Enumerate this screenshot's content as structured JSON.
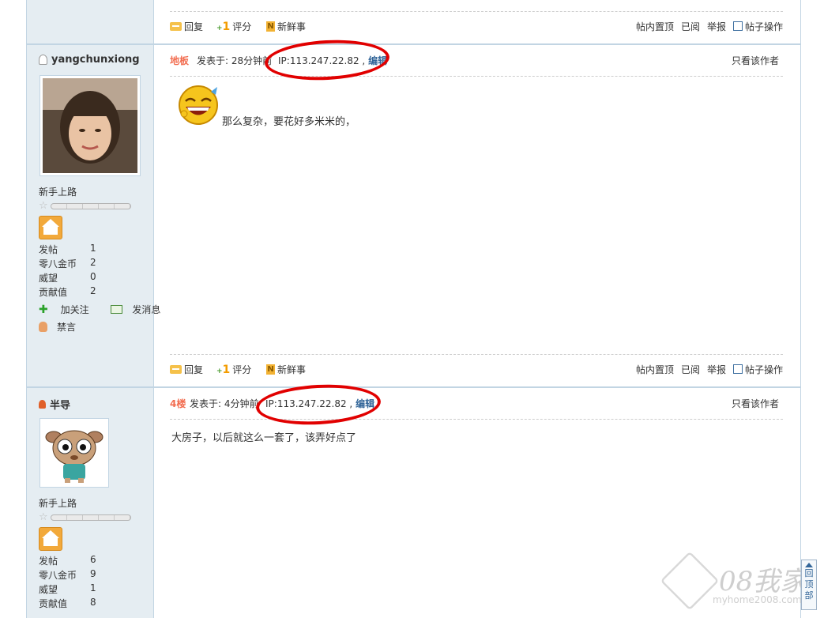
{
  "post_actions": {
    "reply": "回复",
    "rate": "评分",
    "news": "新鲜事",
    "pin": "帖内置顶",
    "read": "已阅",
    "report": "举报",
    "post_ops": "帖子操作"
  },
  "posts": [
    {
      "username": "yangchunxiong",
      "rank": "新手上路",
      "stats": [
        {
          "k": "发帖",
          "v": "1"
        },
        {
          "k": "零八金币",
          "v": "2"
        },
        {
          "k": "威望",
          "v": "0"
        },
        {
          "k": "贡献值",
          "v": "2"
        }
      ],
      "follow": "加关注",
      "message": "发消息",
      "ban": "禁言",
      "floor": "地板",
      "posted": "发表于: 28分钟前",
      "ip": "IP:113.247.22.82 ,",
      "edit": "编辑",
      "only_author": "只看该作者",
      "body": "那么复杂，要花好多米米的，"
    },
    {
      "username": "半导",
      "rank": "新手上路",
      "stats": [
        {
          "k": "发帖",
          "v": "6"
        },
        {
          "k": "零八金币",
          "v": "9"
        },
        {
          "k": "威望",
          "v": "1"
        },
        {
          "k": "贡献值",
          "v": "8"
        }
      ],
      "floor": "4楼",
      "posted": "发表于: 4分钟前",
      "ip": "IP:113.247.22.82 ,",
      "edit": "编辑",
      "only_author": "只看该作者",
      "body": "大房子，以后就这么一套了，该弄好点了"
    }
  ],
  "back_to_top": "回顶部",
  "watermark": {
    "brand": "08我家",
    "url": "myhome2008.com"
  },
  "colors": {
    "sidebar_bg": "#e5edf2",
    "border": "#c2d5e3",
    "floor_label": "#f26c4f",
    "annotation": "#e10000"
  }
}
